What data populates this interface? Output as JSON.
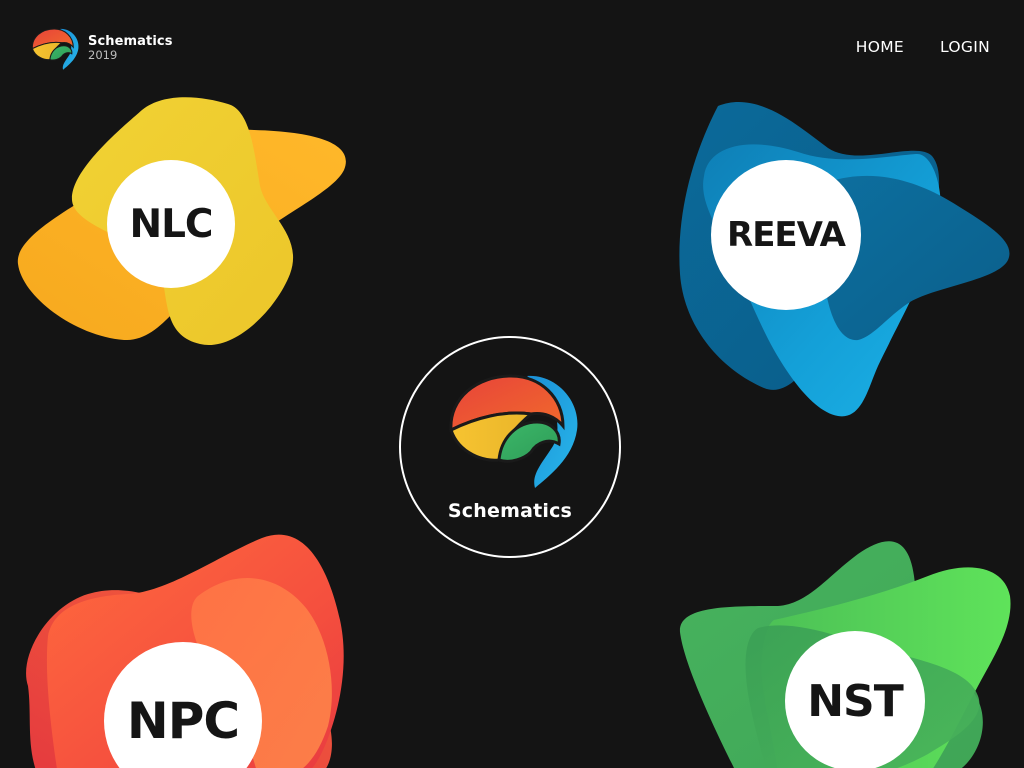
{
  "brand": {
    "name": "Schematics",
    "year": "2019",
    "logo_icon": "schematics-logo-icon"
  },
  "nav": {
    "items": [
      {
        "label": "HOME"
      },
      {
        "label": "LOGIN"
      }
    ]
  },
  "events": [
    {
      "id": "nlc",
      "label": "NLC",
      "colors": [
        "#f7b51f",
        "#f2d233"
      ]
    },
    {
      "id": "reeva",
      "label": "REEVA",
      "colors": [
        "#0b6e9e",
        "#1aa9df"
      ]
    },
    {
      "id": "npc",
      "label": "NPC",
      "colors": [
        "#e8383f",
        "#ff7a45"
      ]
    },
    {
      "id": "nst",
      "label": "NST",
      "colors": [
        "#3fae55",
        "#5ee05a"
      ]
    }
  ],
  "center": {
    "label": "Schematics",
    "logo_icon": "schematics-logo-icon"
  },
  "colors": {
    "background": "#141414",
    "text": "#ffffff",
    "circle": "#ffffff",
    "circle_text": "#151515"
  }
}
